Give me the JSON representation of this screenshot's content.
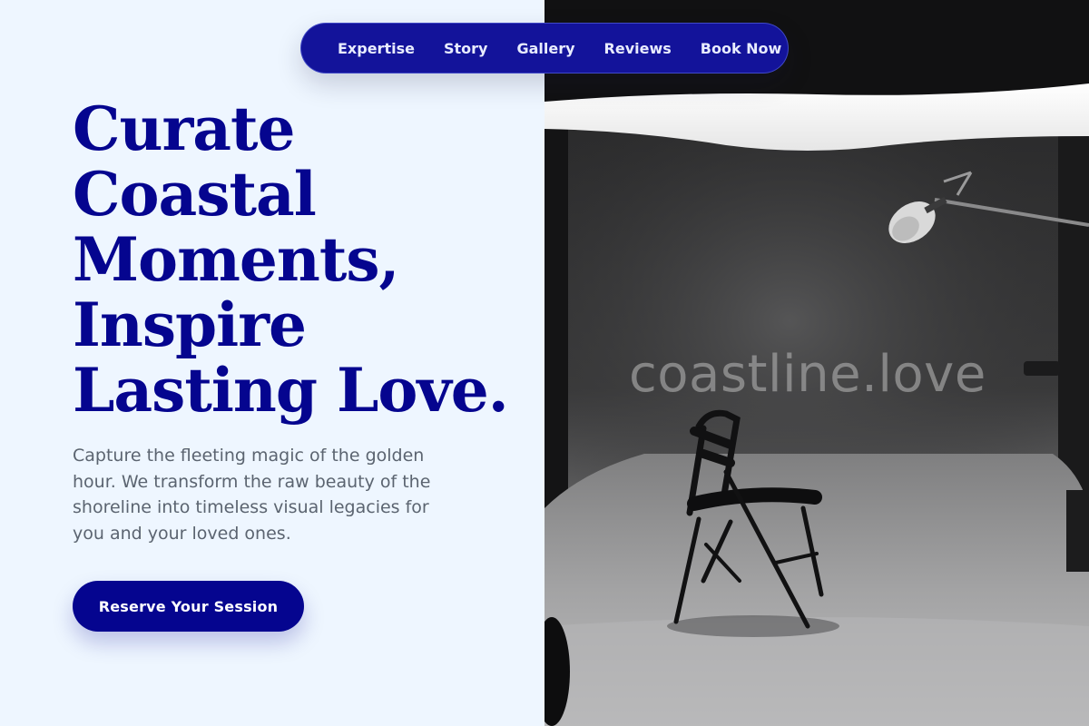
{
  "nav": {
    "items": [
      {
        "label": "Expertise"
      },
      {
        "label": "Story"
      },
      {
        "label": "Gallery"
      },
      {
        "label": "Reviews"
      },
      {
        "label": "Book Now"
      }
    ]
  },
  "hero": {
    "title_lines": [
      "Curate",
      "Coastal",
      "Moments,",
      "Inspire",
      "Lasting Love."
    ],
    "description": "Capture the fleeting magic of the golden hour. We transform the raw beauty of the shoreline into timeless visual legacies for you and your loved ones.",
    "cta_label": "Reserve Your Session"
  },
  "photo": {
    "watermark": "coastline.love",
    "subject": "studio-chair-with-boom-microphone"
  },
  "colors": {
    "accent": "#05058f",
    "nav_bg": "#13139a",
    "background": "#eef6ff",
    "body_text": "#5b6470"
  }
}
